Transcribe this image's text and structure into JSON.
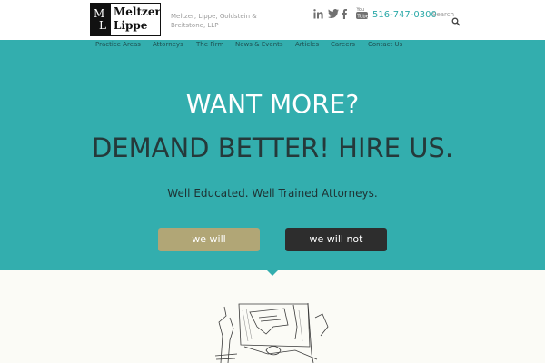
{
  "header": {
    "logo_line1": "Meltzer",
    "logo_line2": "Lippe",
    "logo_mark_m": "M",
    "logo_mark_l": "L",
    "firm_name": "Meltzer, Lippe, Goldstein & Breitstone, LLP",
    "phone": "516-747-0300",
    "search_label": "Search",
    "social": [
      "linkedin-icon",
      "twitter-icon",
      "facebook-icon",
      "youtube-icon"
    ]
  },
  "nav": {
    "items": [
      "Practice Areas",
      "Attorneys",
      "The Firm",
      "News & Events",
      "Articles",
      "Careers",
      "Contact Us"
    ]
  },
  "hero": {
    "headline1": "WANT MORE?",
    "headline2": "DEMAND BETTER! HIRE US.",
    "subhead": "Well Educated. Well Trained Attorneys.",
    "button_will": "we will",
    "button_will_not": "we will not"
  },
  "colors": {
    "teal": "#33aeae",
    "gold_button": "#b1a676",
    "dark_button": "#2d2d2d",
    "phone": "#2aa9a8"
  }
}
